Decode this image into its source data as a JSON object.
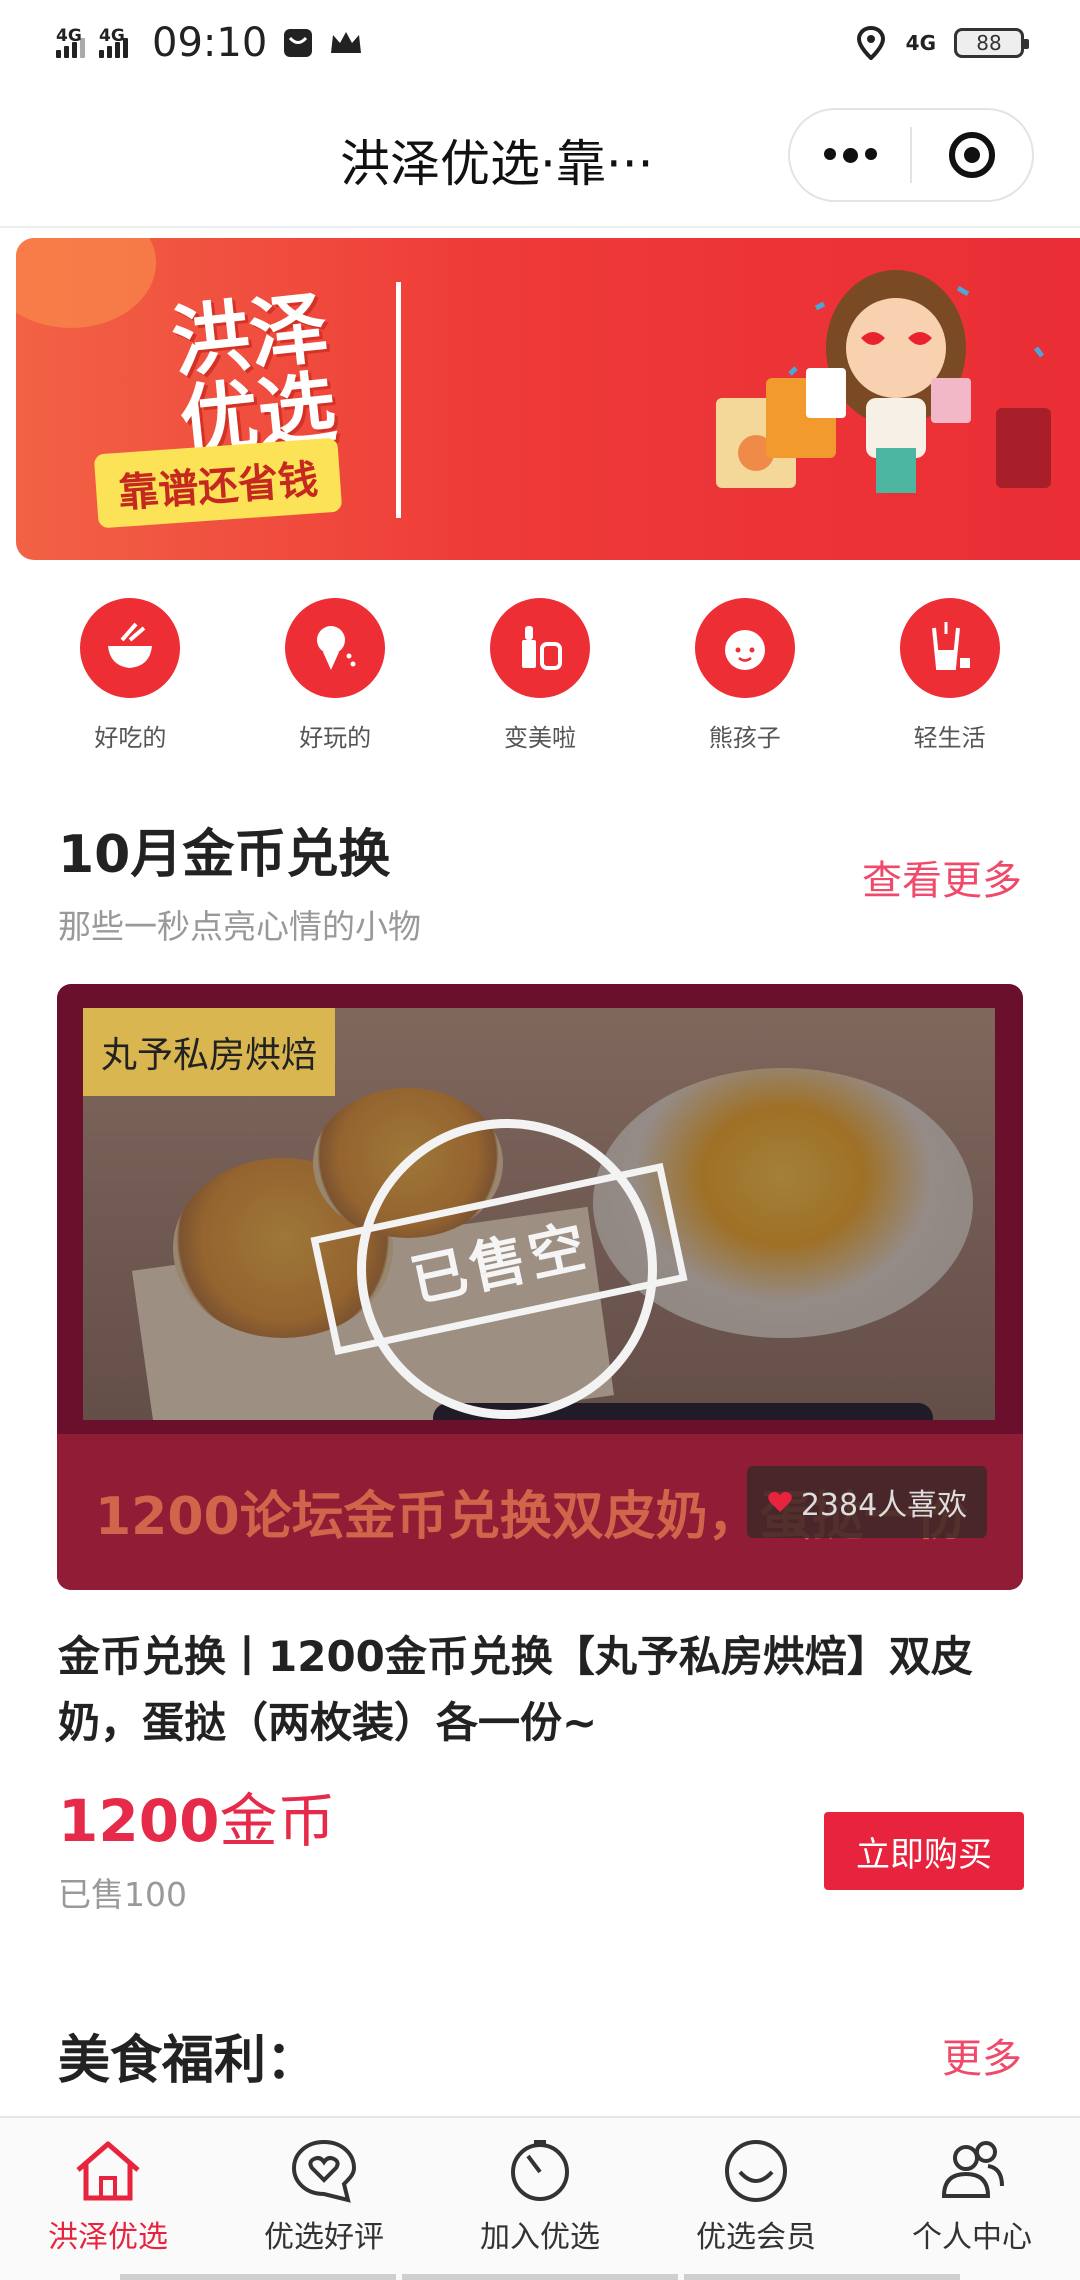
{
  "status_bar": {
    "signal1": "4G",
    "signal2": "4G",
    "time": "09:10",
    "network": "4G",
    "battery": "88"
  },
  "nav": {
    "title": "洪泽优选·靠···"
  },
  "banner": {
    "logo_text": "洪泽优选",
    "slogan": "靠谱还省钱"
  },
  "categories": [
    {
      "label": "好吃的",
      "icon": "bowl-icon"
    },
    {
      "label": "好玩的",
      "icon": "ice-cream-icon"
    },
    {
      "label": "变美啦",
      "icon": "cosmetics-icon"
    },
    {
      "label": "熊孩子",
      "icon": "kid-face-icon"
    },
    {
      "label": "轻生活",
      "icon": "cup-icon"
    }
  ],
  "section1": {
    "title": "10月金币兑换",
    "subtitle": "那些一秒点亮心情的小物",
    "more": "查看更多"
  },
  "product": {
    "shop_tag": "丸予私房烘焙",
    "stamp_text": "已售空",
    "banner_text": "1200论坛金币兑换双皮奶，蛋挞一份",
    "likes": "2384人喜欢",
    "title": "金币兑换丨1200金币兑换【丸予私房烘焙】双皮奶，蛋挞（两枚装）各一份~",
    "price_number": "1200",
    "price_unit": "金币",
    "sold": "已售100",
    "buy_label": "立即购买"
  },
  "section2": {
    "title": "美食福利：",
    "more": "更多"
  },
  "tabs": [
    {
      "label": "洪泽优选",
      "icon": "home-icon",
      "active": true
    },
    {
      "label": "优选好评",
      "icon": "heart-bubble-icon",
      "active": false
    },
    {
      "label": "加入优选",
      "icon": "timer-icon",
      "active": false
    },
    {
      "label": "优选会员",
      "icon": "smile-icon",
      "active": false
    },
    {
      "label": "个人中心",
      "icon": "users-icon",
      "active": false
    }
  ],
  "colors": {
    "accent": "#e8233e",
    "link": "#f04a6a",
    "category_bg": "#ee2e35"
  }
}
